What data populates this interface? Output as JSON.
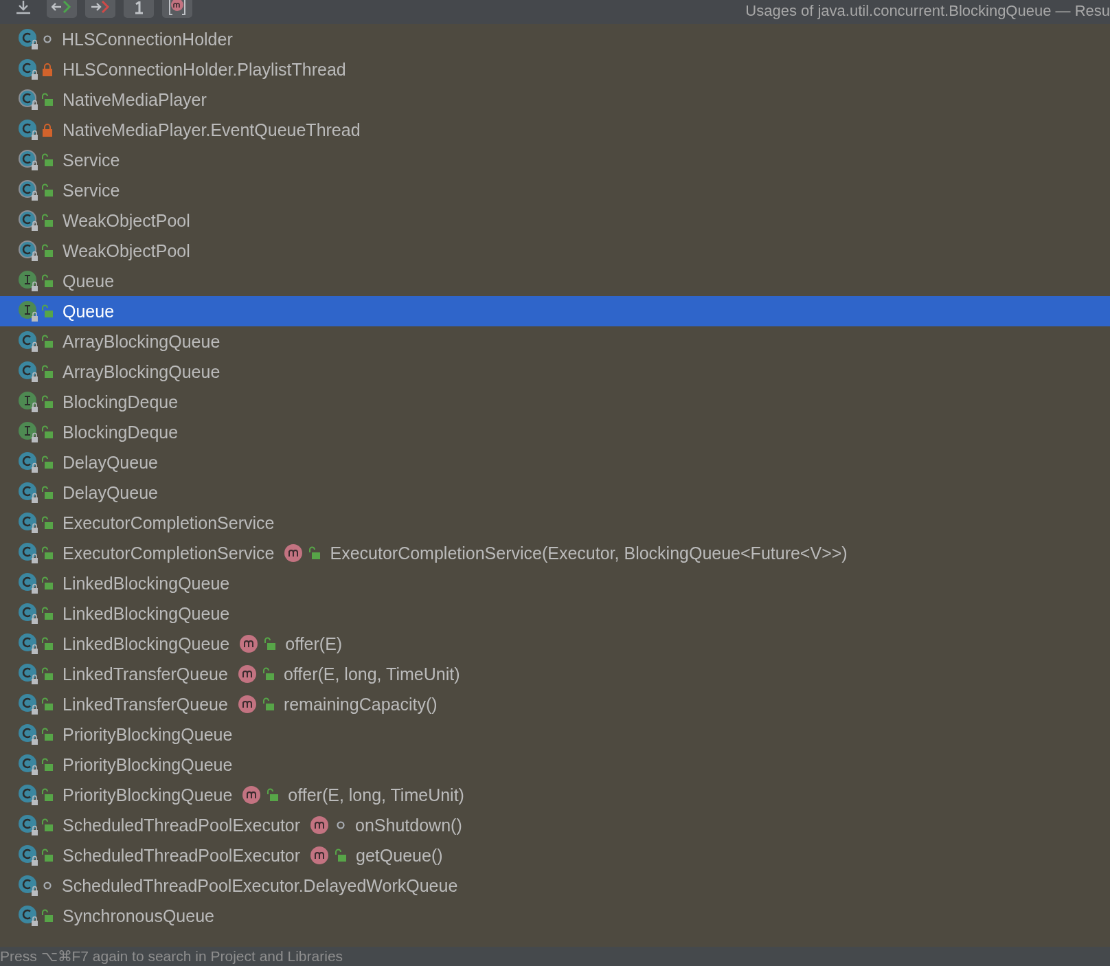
{
  "toolbar": {
    "buttons": [
      {
        "kind": "export",
        "raised": false
      },
      {
        "kind": "prev",
        "raised": true
      },
      {
        "kind": "next",
        "raised": true
      },
      {
        "kind": "one",
        "raised": true
      },
      {
        "kind": "method",
        "raised": true
      }
    ],
    "title": "Usages of java.util.concurrent.BlockingQueue — Resu"
  },
  "results": [
    {
      "name": "HLSConnectionHolder",
      "kind": "class",
      "modifier": {
        "kind": "package"
      },
      "selected": false
    },
    {
      "name": "HLSConnectionHolder.PlaylistThread",
      "kind": "class",
      "modifier": {
        "kind": "private"
      },
      "selected": false
    },
    {
      "name": "NativeMediaPlayer",
      "kind": "abstract",
      "modifier": {
        "kind": "public"
      },
      "selected": false
    },
    {
      "name": "NativeMediaPlayer.EventQueueThread",
      "kind": "class",
      "modifier": {
        "kind": "private"
      },
      "selected": false
    },
    {
      "name": "Service",
      "kind": "abstract",
      "modifier": {
        "kind": "public"
      },
      "selected": false
    },
    {
      "name": "Service",
      "kind": "abstract",
      "modifier": {
        "kind": "public"
      },
      "selected": false
    },
    {
      "name": "WeakObjectPool",
      "kind": "abstract",
      "modifier": {
        "kind": "public"
      },
      "selected": false
    },
    {
      "name": "WeakObjectPool",
      "kind": "abstract",
      "modifier": {
        "kind": "public"
      },
      "selected": false
    },
    {
      "name": "Queue",
      "kind": "interface",
      "modifier": {
        "kind": "public"
      },
      "selected": false
    },
    {
      "name": "Queue",
      "kind": "interface",
      "modifier": {
        "kind": "public"
      },
      "selected": true
    },
    {
      "name": "ArrayBlockingQueue",
      "kind": "class",
      "modifier": {
        "kind": "public"
      },
      "selected": false
    },
    {
      "name": "ArrayBlockingQueue",
      "kind": "class",
      "modifier": {
        "kind": "public"
      },
      "selected": false
    },
    {
      "name": "BlockingDeque",
      "kind": "interface",
      "modifier": {
        "kind": "public"
      },
      "selected": false
    },
    {
      "name": "BlockingDeque",
      "kind": "interface",
      "modifier": {
        "kind": "public"
      },
      "selected": false
    },
    {
      "name": "DelayQueue",
      "kind": "class",
      "modifier": {
        "kind": "public"
      },
      "selected": false
    },
    {
      "name": "DelayQueue",
      "kind": "class",
      "modifier": {
        "kind": "public"
      },
      "selected": false
    },
    {
      "name": "ExecutorCompletionService",
      "kind": "class",
      "modifier": {
        "kind": "public"
      },
      "selected": false
    },
    {
      "name": "ExecutorCompletionService",
      "kind": "class",
      "modifier": {
        "kind": "public"
      },
      "selected": false,
      "method": {
        "name": "ExecutorCompletionService(Executor, BlockingQueue<Future<V>>)",
        "modifier": {
          "kind": "public"
        }
      }
    },
    {
      "name": "LinkedBlockingQueue",
      "kind": "class",
      "modifier": {
        "kind": "public"
      },
      "selected": false
    },
    {
      "name": "LinkedBlockingQueue",
      "kind": "class",
      "modifier": {
        "kind": "public"
      },
      "selected": false
    },
    {
      "name": "LinkedBlockingQueue",
      "kind": "class",
      "modifier": {
        "kind": "public"
      },
      "selected": false,
      "method": {
        "name": "offer(E)",
        "modifier": {
          "kind": "public"
        }
      }
    },
    {
      "name": "LinkedTransferQueue",
      "kind": "class",
      "modifier": {
        "kind": "public"
      },
      "selected": false,
      "method": {
        "name": "offer(E, long, TimeUnit)",
        "modifier": {
          "kind": "public"
        }
      }
    },
    {
      "name": "LinkedTransferQueue",
      "kind": "class",
      "modifier": {
        "kind": "public"
      },
      "selected": false,
      "method": {
        "name": "remainingCapacity()",
        "modifier": {
          "kind": "public"
        }
      }
    },
    {
      "name": "PriorityBlockingQueue",
      "kind": "class",
      "modifier": {
        "kind": "public"
      },
      "selected": false
    },
    {
      "name": "PriorityBlockingQueue",
      "kind": "class",
      "modifier": {
        "kind": "public"
      },
      "selected": false
    },
    {
      "name": "PriorityBlockingQueue",
      "kind": "class",
      "modifier": {
        "kind": "public"
      },
      "selected": false,
      "method": {
        "name": "offer(E, long, TimeUnit)",
        "modifier": {
          "kind": "public"
        }
      }
    },
    {
      "name": "ScheduledThreadPoolExecutor",
      "kind": "class",
      "modifier": {
        "kind": "public"
      },
      "selected": false,
      "method": {
        "name": "onShutdown()",
        "modifier": {
          "kind": "package"
        }
      }
    },
    {
      "name": "ScheduledThreadPoolExecutor",
      "kind": "class",
      "modifier": {
        "kind": "public"
      },
      "selected": false,
      "method": {
        "name": "getQueue()",
        "modifier": {
          "kind": "public"
        }
      }
    },
    {
      "name": "ScheduledThreadPoolExecutor.DelayedWorkQueue",
      "kind": "class",
      "modifier": {
        "kind": "package"
      },
      "selected": false
    },
    {
      "name": "SynchronousQueue",
      "kind": "class",
      "modifier": {
        "kind": "public"
      },
      "selected": false
    }
  ],
  "status_bar": {
    "text": "Press ⌥⌘F7 again to search in Project and Libraries"
  }
}
